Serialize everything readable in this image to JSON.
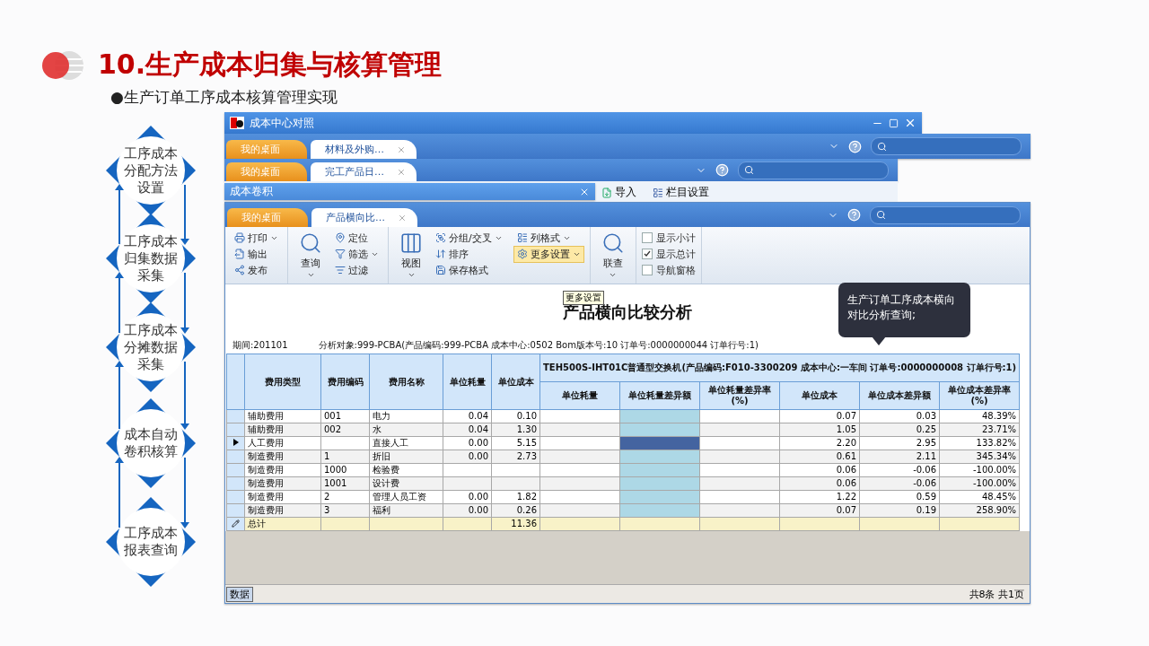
{
  "slide": {
    "title": "10.生产成本归集与核算管理",
    "subtitle": "●生产订单工序成本核算管理实现"
  },
  "flow_steps": [
    {
      "lines": [
        "工序成本",
        "分配方法",
        "设置"
      ]
    },
    {
      "lines": [
        "工序成本",
        "归集数据",
        "采集"
      ]
    },
    {
      "lines": [
        "工序成本",
        "分摊数据",
        "采集"
      ]
    },
    {
      "lines": [
        "成本自动",
        "卷积核算"
      ]
    },
    {
      "lines": [
        "工序成本",
        "报表查询"
      ]
    }
  ],
  "background_windows": [
    {
      "kind": "titlebar",
      "title": "成本中心对照",
      "controls": true
    },
    {
      "kind": "tabbar",
      "tabs": [
        {
          "label": "我的桌面",
          "selected": false
        },
        {
          "label": "材料及外购…",
          "selected": true
        }
      ]
    },
    {
      "kind": "tabbar",
      "tabs": [
        {
          "label": "我的桌面",
          "selected": false
        },
        {
          "label": "完工产品日…",
          "selected": true
        }
      ],
      "toolbar": [
        "导入",
        "栏目设置"
      ]
    },
    {
      "kind": "titlebar",
      "title": "成本卷积",
      "controls": false
    }
  ],
  "main_window": {
    "tabs": [
      {
        "label": "我的桌面",
        "selected": false
      },
      {
        "label": "产品横向比…",
        "selected": true
      }
    ],
    "ribbon": [
      {
        "items": [
          {
            "kind": "small",
            "label": "打印",
            "dropdown": true
          },
          {
            "kind": "small",
            "label": "输出",
            "dropdown": false
          },
          {
            "kind": "small",
            "label": "发布",
            "dropdown": false
          }
        ]
      },
      {
        "items": [
          {
            "kind": "large",
            "label": "查询",
            "dropdown": true
          },
          {
            "kind": "small",
            "label": "定位",
            "dropdown": false
          },
          {
            "kind": "small",
            "label": "筛选",
            "dropdown": true
          },
          {
            "kind": "small",
            "label": "过滤",
            "dropdown": false
          }
        ]
      },
      {
        "items": [
          {
            "kind": "large",
            "label": "视图",
            "dropdown": true
          },
          {
            "kind": "small",
            "label": "分组/交叉",
            "dropdown": true
          },
          {
            "kind": "small",
            "label": "排序",
            "dropdown": false
          },
          {
            "kind": "small",
            "label": "保存格式",
            "dropdown": false
          },
          {
            "kind": "small",
            "label": "列格式",
            "dropdown": true
          },
          {
            "kind": "small",
            "label": "更多设置",
            "dropdown": true,
            "highlighted": true
          }
        ]
      },
      {
        "items": [
          {
            "kind": "large",
            "label": "联查",
            "dropdown": true
          }
        ]
      },
      {
        "items": [
          {
            "kind": "check",
            "label": "显示小计",
            "checked": false
          },
          {
            "kind": "check",
            "label": "显示总计",
            "checked": true
          },
          {
            "kind": "check",
            "label": "导航窗格",
            "checked": false
          }
        ]
      }
    ],
    "tooltip": "更多设置",
    "callout": "生产订单工序成本横向对比分析查询;",
    "report_title": "产品横向比较分析",
    "period": "期间:201101",
    "analysis_object": "分析对象:999-PCBA(产品编码:999-PCBA 成本中心:0502 Bom版本号:10 订单号:0000000044 订单行号:1)",
    "table": {
      "columns": [
        "费用类型",
        "费用编码",
        "费用名称",
        "单位耗量",
        "单位成本"
      ],
      "group_header": "TEH500S-IHT01C普通型交换机(产品编码:F010-3300209 成本中心:一车间 订单号:0000000008 订单行号:1)",
      "sub_columns": [
        {
          "label": "单位耗量",
          "highlighted": false
        },
        {
          "label": "单位耗量差异额",
          "highlighted": true
        },
        {
          "label": "单位耗量差异率(%)",
          "highlighted": false
        },
        {
          "label": "单位成本",
          "highlighted": false
        },
        {
          "label": "单位成本差异额",
          "highlighted": false
        },
        {
          "label": "单位成本差异率(%)",
          "highlighted": false
        }
      ],
      "rows": [
        {
          "selected": false,
          "cells": [
            "辅助费用",
            "001",
            "电力",
            "0.04",
            "0.10",
            null,
            null,
            null,
            "0.07",
            "0.03",
            "48.39%"
          ]
        },
        {
          "selected": false,
          "cells": [
            "辅助费用",
            "002",
            "水",
            "0.04",
            "1.30",
            null,
            null,
            null,
            "1.05",
            "0.25",
            "23.71%"
          ]
        },
        {
          "selected": true,
          "cells": [
            "人工费用",
            null,
            "直接人工",
            "0.00",
            "5.15",
            null,
            null,
            null,
            "2.20",
            "2.95",
            "133.82%"
          ]
        },
        {
          "selected": false,
          "cells": [
            "制造费用",
            "1",
            "折旧",
            "0.00",
            "2.73",
            null,
            null,
            null,
            "0.61",
            "2.11",
            "345.34%"
          ]
        },
        {
          "selected": false,
          "cells": [
            "制造费用",
            "1000",
            "检验费",
            null,
            null,
            null,
            null,
            null,
            "0.06",
            "-0.06",
            "-100.00%"
          ]
        },
        {
          "selected": false,
          "cells": [
            "制造费用",
            "1001",
            "设计费",
            null,
            null,
            null,
            null,
            null,
            "0.06",
            "-0.06",
            "-100.00%"
          ]
        },
        {
          "selected": false,
          "cells": [
            "制造费用",
            "2",
            "管理人员工资",
            "0.00",
            "1.82",
            null,
            null,
            null,
            "1.22",
            "0.59",
            "48.45%"
          ]
        },
        {
          "selected": false,
          "cells": [
            "制造费用",
            "3",
            "福利",
            "0.00",
            "0.26",
            null,
            null,
            null,
            "0.07",
            "0.19",
            "258.90%"
          ]
        }
      ],
      "total": {
        "label": "总计",
        "unit_cost": "11.36"
      }
    },
    "status_bar": {
      "view": "数据",
      "summary": "共8条 共1页"
    }
  }
}
